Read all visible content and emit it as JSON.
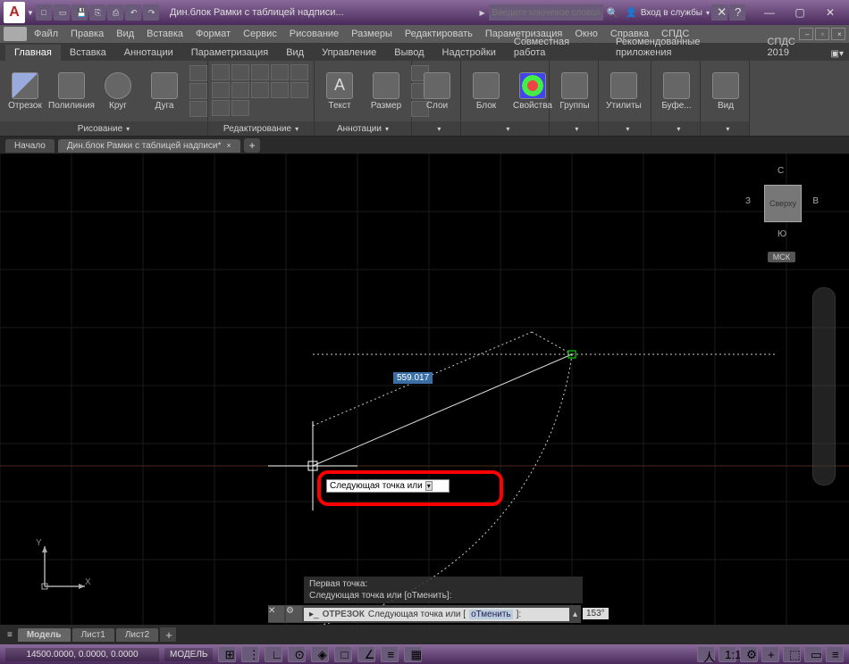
{
  "app": {
    "logo_letter": "A"
  },
  "title": {
    "doc": "Дин.блок Рамки с таблицей надписи..."
  },
  "search": {
    "placeholder": "Введите ключевое слово/фразу"
  },
  "signin": {
    "label": "Вход в службы"
  },
  "menus": [
    "Файл",
    "Правка",
    "Вид",
    "Вставка",
    "Формат",
    "Сервис",
    "Рисование",
    "Размеры",
    "Редактировать",
    "Параметризация",
    "Окно",
    "Справка",
    "СПДС"
  ],
  "ribbon_tabs": [
    "Главная",
    "Вставка",
    "Аннотации",
    "Параметризация",
    "Вид",
    "Управление",
    "Вывод",
    "Надстройки",
    "Совместная работа",
    "Рекомендованные приложения",
    "СПДС 2019"
  ],
  "ribbon": {
    "draw": {
      "title": "Рисование",
      "buttons": [
        "Отрезок",
        "Полилиния",
        "Круг",
        "Дуга"
      ]
    },
    "edit": {
      "title": "Редактирование"
    },
    "annot": {
      "title": "Аннотации",
      "buttons": [
        "Текст",
        "Размер"
      ]
    },
    "layers": {
      "title": "Слои"
    },
    "block": {
      "title": "Блок",
      "buttons": [
        "Блок",
        "Свойства"
      ]
    },
    "groups": {
      "title": "Группы"
    },
    "utils": {
      "title": "Утилиты"
    },
    "clip": {
      "title": "Буфе..."
    },
    "view": {
      "title": "Вид"
    }
  },
  "filetabs": {
    "start": "Начало",
    "doc": "Дин.блок Рамки с таблицей надписи*"
  },
  "viewcube": {
    "top": "Сверху",
    "n": "С",
    "s": "Ю",
    "e": "В",
    "w": "З",
    "wcs": "МСК"
  },
  "canvas": {
    "dyn_value": "559.017",
    "dyn_prompt": "Следующая точка или",
    "cmd_hist1": "Первая точка:",
    "cmd_hist2": "Следующая точка или [оТменить]:",
    "cmd_name": "ОТРЕЗОК",
    "cmd_prompt": "Следующая точка или [",
    "cmd_opt": "оТменить",
    "cmd_end": "]:",
    "angle": "153°"
  },
  "ucs": {
    "x": "X",
    "y": "Y"
  },
  "model_tabs": [
    "Модель",
    "Лист1",
    "Лист2"
  ],
  "status": {
    "coords": "14500.0000, 0.0000, 0.0000",
    "mode": "МОДЕЛЬ"
  }
}
